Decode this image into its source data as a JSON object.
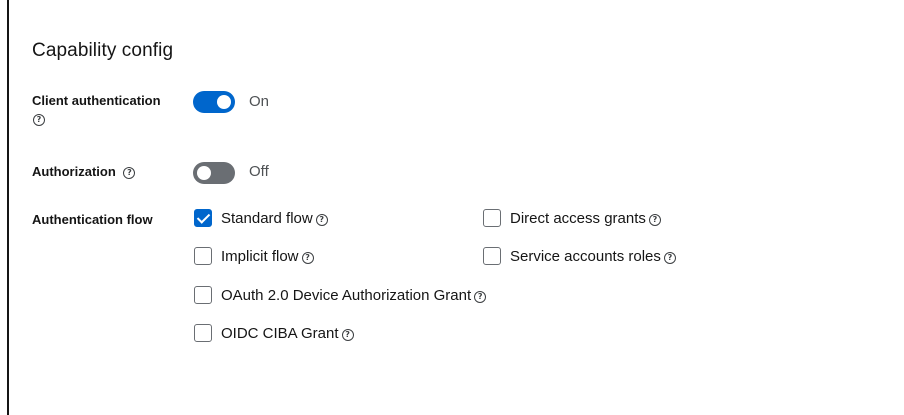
{
  "section": {
    "title": "Capability config"
  },
  "client_authentication": {
    "label": "Client authentication",
    "state": "On"
  },
  "authorization": {
    "label": "Authorization",
    "state": "Off"
  },
  "authentication_flow": {
    "label": "Authentication flow",
    "options": [
      {
        "label": "Standard flow",
        "checked": true
      },
      {
        "label": "Direct access grants",
        "checked": false
      },
      {
        "label": "Implicit flow",
        "checked": false
      },
      {
        "label": "Service accounts roles",
        "checked": false
      },
      {
        "label": "OAuth 2.0 Device Authorization Grant",
        "checked": false
      },
      {
        "label": "OIDC CIBA Grant",
        "checked": false
      }
    ]
  },
  "colors": {
    "accent": "#0066cc",
    "switch_off": "#6a6e73",
    "text": "#151515"
  },
  "icons": {
    "help": "question-circle-icon"
  }
}
